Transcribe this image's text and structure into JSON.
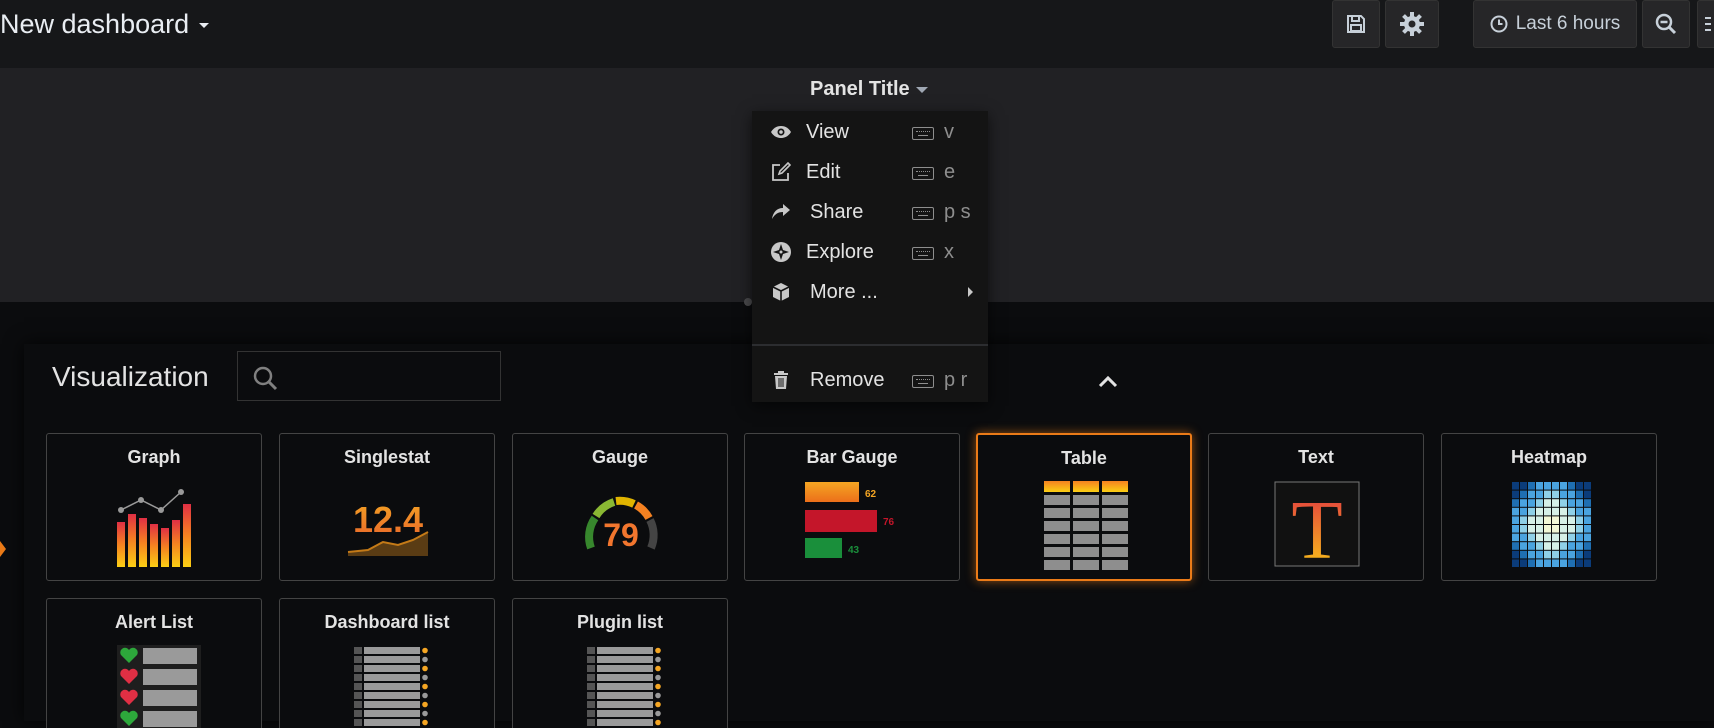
{
  "header": {
    "dashboard_title": "New dashboard",
    "time_range": "Last 6 hours"
  },
  "panel": {
    "title": "Panel Title"
  },
  "panel_menu": {
    "items": [
      {
        "label": "View",
        "shortcut": "v",
        "icon": "eye-icon"
      },
      {
        "label": "Edit",
        "shortcut": "e",
        "icon": "edit-icon"
      },
      {
        "label": "Share",
        "shortcut": "p s",
        "icon": "share-icon"
      },
      {
        "label": "Explore",
        "shortcut": "x",
        "icon": "compass-icon"
      },
      {
        "label": "More ...",
        "shortcut": "",
        "icon": "cube-icon"
      },
      {
        "label": "Remove",
        "shortcut": "p r",
        "icon": "trash-icon"
      }
    ]
  },
  "visualization": {
    "title": "Visualization",
    "search_placeholder": "",
    "cards": [
      {
        "name": "Graph",
        "selected": false
      },
      {
        "name": "Singlestat",
        "selected": false
      },
      {
        "name": "Gauge",
        "selected": false
      },
      {
        "name": "Bar Gauge",
        "selected": false
      },
      {
        "name": "Table",
        "selected": true
      },
      {
        "name": "Text",
        "selected": false
      },
      {
        "name": "Heatmap",
        "selected": false
      },
      {
        "name": "Alert List",
        "selected": false
      },
      {
        "name": "Dashboard list",
        "selected": false
      },
      {
        "name": "Plugin list",
        "selected": false
      }
    ],
    "thumbnails": {
      "singlestat_value": "12.4",
      "gauge_value": "79",
      "bar_gauge_values": [
        "62",
        "76",
        "43"
      ],
      "text_glyph": "T"
    }
  },
  "colors": {
    "accent": "#eb7b18",
    "background": "#0b0c0e",
    "panel_bg": "#212124",
    "nav_bg": "#161719"
  }
}
